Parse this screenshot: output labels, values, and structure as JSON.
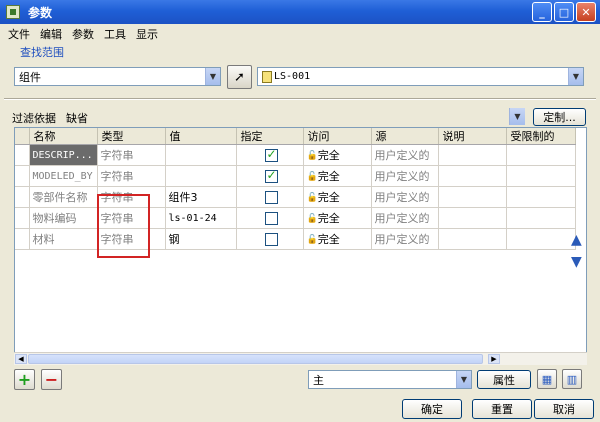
{
  "window": {
    "title": "参数"
  },
  "menu": [
    "文件",
    "编辑",
    "参数",
    "工具",
    "显示"
  ],
  "scope": {
    "label": "查找范围",
    "type_value": "组件",
    "object_value": "LS-001"
  },
  "filter": {
    "label": "过滤依据",
    "value": "缺省",
    "customize_label": "定制..."
  },
  "table": {
    "columns": [
      "名称",
      "类型",
      "值",
      "指定",
      "访问",
      "源",
      "说明",
      "受限制的"
    ],
    "rows": [
      {
        "name": "DESCRIP...",
        "type": "字符串",
        "value": "",
        "designated": true,
        "access": "完全",
        "source": "用户定义的"
      },
      {
        "name": "MODELED_BY",
        "type": "字符串",
        "value": "",
        "designated": true,
        "access": "完全",
        "source": "用户定义的"
      },
      {
        "name": "零部件名称",
        "type": "字符串",
        "value": "组件3",
        "designated": false,
        "access": "完全",
        "source": "用户定义的"
      },
      {
        "name": "物料编码",
        "type": "字符串",
        "value": "ls-01-24",
        "designated": false,
        "access": "完全",
        "source": "用户定义的"
      },
      {
        "name": "材料",
        "type": "字符串",
        "value": "钢",
        "designated": false,
        "access": "完全",
        "source": "用户定义的"
      }
    ]
  },
  "bottom": {
    "view_value": "主",
    "properties_label": "属性",
    "ok_label": "确定",
    "reset_label": "重置",
    "cancel_label": "取消"
  },
  "colors": {
    "title_bar": "#1f5fd6",
    "selection": "#6b6b6b",
    "highlight_box": "#d22424"
  }
}
